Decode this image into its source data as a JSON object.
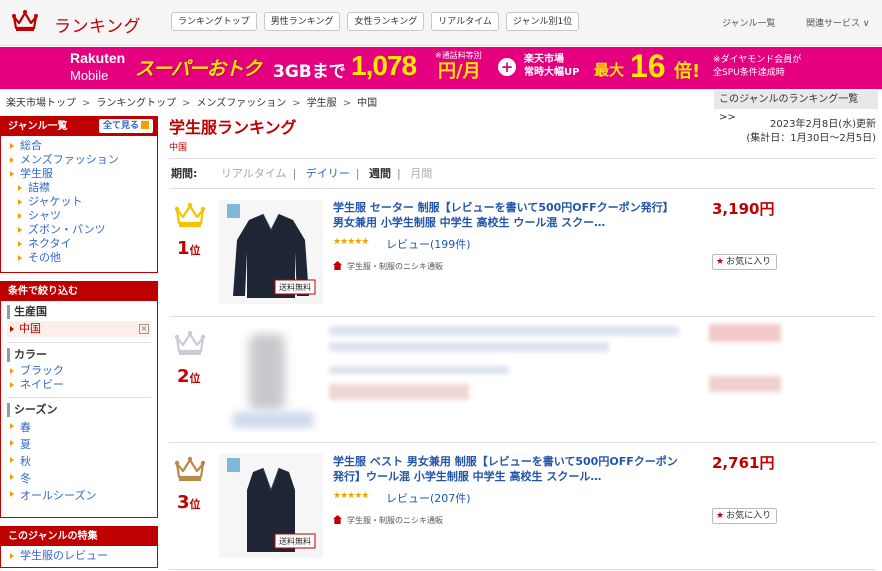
{
  "header": {
    "title": "ランキング",
    "tabs": [
      "ランキングトップ",
      "男性ランキング",
      "女性ランキング",
      "リアルタイム",
      "ジャンル別1位"
    ],
    "genre_list": "ジャンル一覧",
    "related": "関連サービス ∨"
  },
  "banner": {
    "brand": "Rakuten",
    "brand2": "Mobile",
    "campaign": "スーパーおトク",
    "plan": "3GBまで",
    "price": "1,078",
    "price_unit": "円/月",
    "note1": "※通話料等別",
    "plus": "+",
    "ichiba": "楽天市場",
    "ichiba2": "常時大幅UP",
    "max": "最大",
    "times": "16",
    "times_unit": "倍!",
    "note2a": "※ダイヤモンド会員が",
    "note2b": "全SPU条件達成時"
  },
  "breadcrumb": [
    "楽天市場トップ",
    "ランキングトップ",
    "メンズファッション",
    "学生服",
    "中国"
  ],
  "genre_ranking_link": "このジャンルのランキング一覧 >>",
  "sidebar": {
    "genre_head": "ジャンル一覧",
    "see_all": "全て見る",
    "genres": [
      "総合",
      "メンズファッション",
      "学生服"
    ],
    "subgenres": [
      "詰襟",
      "ジャケット",
      "シャツ",
      "ズボン・パンツ",
      "ネクタイ",
      "その他"
    ],
    "filter_head": "条件で絞り込む",
    "origin_label": "生産国",
    "origin_selected": "中国",
    "color_label": "カラー",
    "colors": [
      "ブラック",
      "ネイビー"
    ],
    "season_label": "シーズン",
    "seasons": [
      "春",
      "夏",
      "秋",
      "冬",
      "オールシーズン"
    ],
    "feature_head": "このジャンルの特集",
    "features": [
      "学生服のレビュー"
    ]
  },
  "main": {
    "title": "学生服ランキング",
    "subtitle": "中国",
    "updated": "2023年2月8日(水)更新",
    "range": "(集計日：1月30日〜2月5日)",
    "period_label": "期間:",
    "periods": [
      "リアルタイム",
      "デイリー",
      "週間",
      "月間"
    ]
  },
  "items": [
    {
      "rank": "1",
      "rank_suffix": "位",
      "title": "学生服 セーター 制服【レビューを書いて500円OFFクーポン発行】男女兼用 小学生制服 中学生 高校生 ウール混 スクー…",
      "stars": "★★★★★",
      "reviews": "レビュー(199件)",
      "shop": "学生服・制服のニシキ通販",
      "price": "3,190円",
      "fav": "お気に入り",
      "free_ship": "送料無料",
      "crown_color": "#f5c400"
    },
    {
      "rank": "2",
      "rank_suffix": "位",
      "crown_color": "#c8ccd6"
    },
    {
      "rank": "3",
      "rank_suffix": "位",
      "title": "学生服 ベスト 男女兼用 制服【レビューを書いて500円OFFクーポン発行】ウール混 小学生制服 中学生 高校生 スクール…",
      "stars": "★★★★★",
      "reviews": "レビュー(207件)",
      "shop": "学生服・制服のニシキ通販",
      "price": "2,761円",
      "fav": "お気に入り",
      "free_ship": "送料無料",
      "crown_color": "#b98a4c"
    }
  ]
}
